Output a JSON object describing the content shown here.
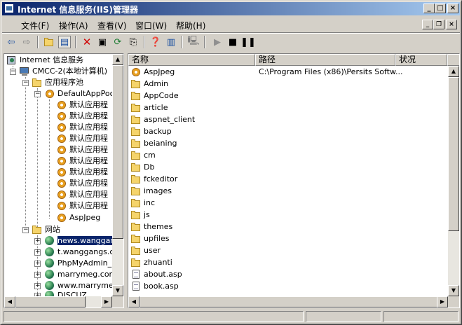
{
  "window": {
    "title": "Internet 信息服务(IIS)管理器",
    "controls": [
      "minimize",
      "maximize",
      "close"
    ]
  },
  "menu": {
    "items": [
      "文件(F)",
      "操作(A)",
      "查看(V)",
      "窗口(W)",
      "帮助(H)"
    ]
  },
  "toolbar": {
    "buttons": [
      "back-arrow-icon",
      "forward-arrow-icon",
      "up-folder-icon",
      "show-tree-icon",
      "delete-icon",
      "properties-icon",
      "refresh-icon",
      "export-icon",
      "help-icon",
      "console-icon",
      "computer-icon",
      "play-icon",
      "stop-icon",
      "pause-icon"
    ]
  },
  "tree": {
    "root": "Internet 信息服务",
    "computer": "CMCC-2(本地计算机)",
    "app_pools": "应用程序池",
    "default_pool": "DefaultAppPool",
    "pool_items": [
      "默认应用程",
      "默认应用程",
      "默认应用程",
      "默认应用程",
      "默认应用程",
      "默认应用程",
      "默认应用程",
      "默认应用程",
      "默认应用程",
      "默认应用程"
    ],
    "aspjpeg": "AspJpeg",
    "websites": "网站",
    "sites": [
      "news.wanggan",
      "t.wanggangs.cc",
      "PhpMyAdmin_H",
      "marrymeg.com",
      "www.marrymeg",
      "DISCUZ"
    ]
  },
  "list": {
    "columns": [
      "名称",
      "路径",
      "状况"
    ],
    "rows": [
      {
        "name": "AspJpeg",
        "path": "C:\\Program Files (x86)\\Persits Softw...",
        "icon": "gear"
      },
      {
        "name": "Admin",
        "path": "",
        "icon": "folder"
      },
      {
        "name": "AppCode",
        "path": "",
        "icon": "folder"
      },
      {
        "name": "article",
        "path": "",
        "icon": "folder"
      },
      {
        "name": "aspnet_client",
        "path": "",
        "icon": "folder"
      },
      {
        "name": "backup",
        "path": "",
        "icon": "folder"
      },
      {
        "name": "beianing",
        "path": "",
        "icon": "folder"
      },
      {
        "name": "cm",
        "path": "",
        "icon": "folder"
      },
      {
        "name": "Db",
        "path": "",
        "icon": "folder"
      },
      {
        "name": "fckeditor",
        "path": "",
        "icon": "folder"
      },
      {
        "name": "images",
        "path": "",
        "icon": "folder"
      },
      {
        "name": "inc",
        "path": "",
        "icon": "folder"
      },
      {
        "name": "js",
        "path": "",
        "icon": "folder"
      },
      {
        "name": "themes",
        "path": "",
        "icon": "folder"
      },
      {
        "name": "upfiles",
        "path": "",
        "icon": "folder"
      },
      {
        "name": "user",
        "path": "",
        "icon": "folder"
      },
      {
        "name": "zhuanti",
        "path": "",
        "icon": "folder"
      },
      {
        "name": "about.asp",
        "path": "",
        "icon": "doc"
      },
      {
        "name": "book.asp",
        "path": "",
        "icon": "doc"
      }
    ]
  }
}
